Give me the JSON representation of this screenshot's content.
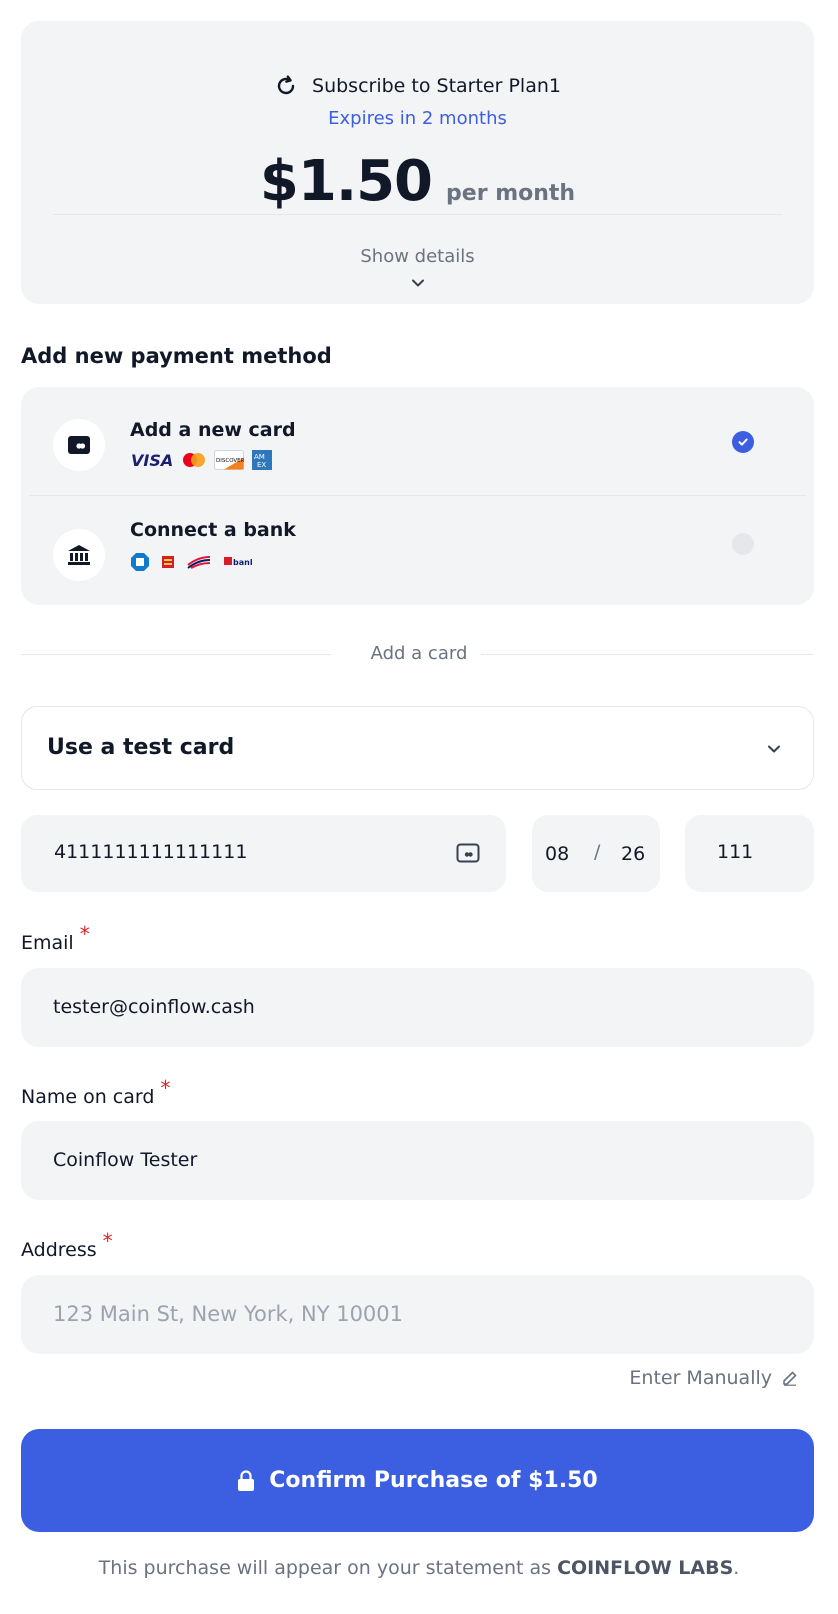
{
  "summary": {
    "title": "Subscribe to Starter Plan1",
    "expires": "Expires in 2 months",
    "price": "$1.50",
    "period": "per month",
    "show_details": "Show details"
  },
  "payment": {
    "section_title": "Add new payment method",
    "methods": [
      {
        "label": "Add a new card",
        "selected": true,
        "brands": [
          "VISA",
          "Mastercard",
          "DISCOVER",
          "AMEX"
        ]
      },
      {
        "label": "Connect a bank",
        "selected": false,
        "brands": [
          "Chase",
          "Wells Fargo",
          "Bank of America",
          "US bank"
        ]
      }
    ]
  },
  "divider_text": "Add a card",
  "test_card": {
    "label": "Use a test card"
  },
  "card": {
    "number": "4111111111111111",
    "exp_month": "08",
    "exp_separator": "/",
    "exp_year": "26",
    "cvv": "111"
  },
  "email": {
    "label": "Email",
    "required": "*",
    "value": "tester@coinflow.cash"
  },
  "name": {
    "label": "Name on card",
    "required": "*",
    "value": "Coinflow Tester"
  },
  "address": {
    "label": "Address",
    "required": "*",
    "placeholder": "123 Main St, New York, NY 10001",
    "enter_manually": "Enter Manually"
  },
  "confirm": {
    "label": "Confirm Purchase of $1.50"
  },
  "footer": {
    "prefix": "This purchase will appear on your statement as ",
    "merchant": "COINFLOW LABS",
    "suffix": "."
  },
  "colors": {
    "accent": "#3b5fe0",
    "required": "#dc2626",
    "panel": "#f3f4f6"
  }
}
